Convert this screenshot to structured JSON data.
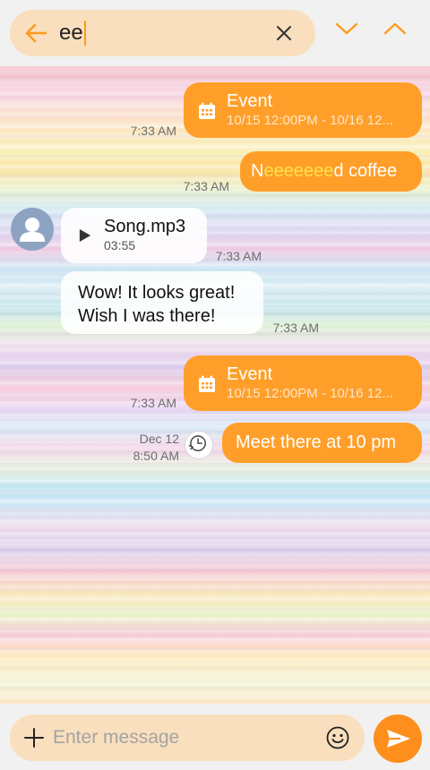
{
  "search": {
    "query": "ee",
    "back_icon": "arrow-left-icon",
    "clear_icon": "close-icon",
    "prev_icon": "chevron-down-icon",
    "next_icon": "chevron-up-icon"
  },
  "messages": {
    "event1": {
      "title": "Event",
      "dates": "10/15 12:00PM - 10/16 12...",
      "time": "7:33 AM"
    },
    "coffee": {
      "prefix": "N",
      "highlight": "eeeeeee",
      "suffix": "d coffee",
      "time": "7:33 AM"
    },
    "song": {
      "title": "Song.mp3",
      "duration": "03:55",
      "time": "7:33 AM"
    },
    "wow": {
      "line1": "Wow! It looks great!",
      "line2": "Wish I was there!",
      "time": "7:33 AM"
    },
    "event2": {
      "title": "Event",
      "dates": "10/15 12:00PM - 10/16 12...",
      "time": "7:33 AM"
    },
    "scheduled": {
      "text": "Meet there at 10 pm",
      "date": "Dec 12",
      "time": "8:50 AM"
    }
  },
  "composer": {
    "placeholder": "Enter message"
  },
  "colors": {
    "accent": "#ff9f2a",
    "pill": "#f9dfbd",
    "highlight": "#ffe34a"
  }
}
